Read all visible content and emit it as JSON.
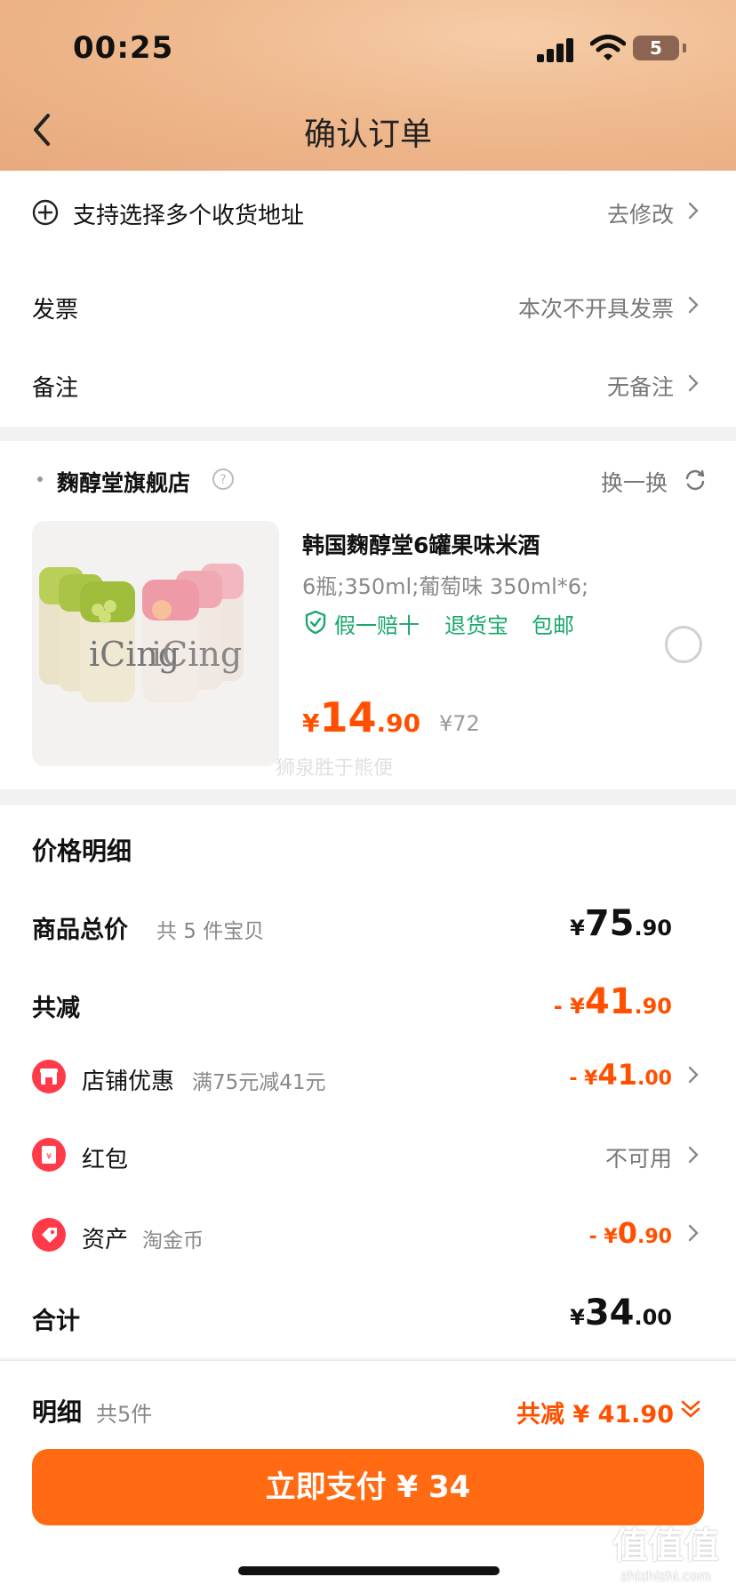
{
  "status": {
    "time": "00:25",
    "battery": "5"
  },
  "nav": {
    "title": "确认订单"
  },
  "address": {
    "label": "支持选择多个收货地址",
    "action": "去修改"
  },
  "invoice": {
    "label": "发票",
    "value": "本次不开具发票"
  },
  "remark": {
    "label": "备注",
    "value": "无备注"
  },
  "shop": {
    "name": "麴醇堂旗舰店",
    "switch_label": "换一换"
  },
  "product": {
    "title": "韩国麴醇堂6罐果味米酒",
    "spec": "6瓶;350ml;葡萄味 350ml*6;",
    "tags": [
      "假一赔十",
      "退货宝",
      "包邮"
    ],
    "price_yen": "¥",
    "price_int": "14",
    "price_dec": ".90",
    "orig_price": "¥72",
    "image_brand": "iCing",
    "watermark": "狮泉胜于熊便"
  },
  "price_detail": {
    "heading": "价格明细",
    "total": {
      "label": "商品总价",
      "sub": "共 5 件宝贝",
      "yen": "¥",
      "int": "75",
      "dec": ".90"
    },
    "reduce": {
      "label": "共减",
      "prefix": "- ¥",
      "int": "41",
      "dec": ".90"
    },
    "shop_coupon": {
      "label": "店铺优惠",
      "sub": "满75元减41元",
      "prefix": "- ¥",
      "int": "41",
      "dec": ".00"
    },
    "red_packet": {
      "label": "红包",
      "value": "不可用"
    },
    "asset": {
      "label": "资产",
      "sub": "淘金币",
      "prefix": "- ¥",
      "int": "0",
      "dec": ".90"
    },
    "sum": {
      "label": "合计",
      "yen": "¥",
      "int": "34",
      "dec": ".00"
    }
  },
  "bottom": {
    "detail_label": "明细",
    "count": "共5件",
    "reduce_text": "共减 ¥ 41.90",
    "pay_button": "立即支付 ¥ 34"
  },
  "corner_logo": {
    "text": "值值值",
    "sub": "zhizhizhi.com"
  },
  "colors": {
    "accent": "#ff5000",
    "green": "#1aa86c",
    "header": "#efb98e",
    "pay": "#ff6a13"
  }
}
